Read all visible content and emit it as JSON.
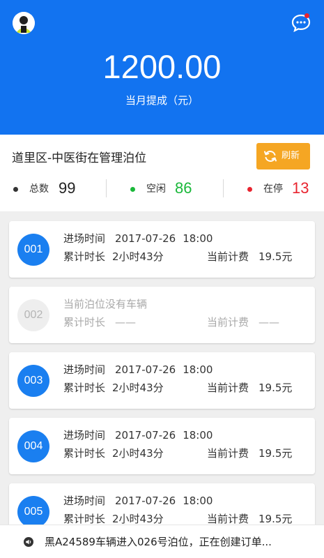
{
  "header": {
    "amount": "1200.00",
    "amount_label": "当月提成（元）"
  },
  "lot": {
    "title": "道里区-中医街在管理泊位",
    "refresh_label": "刷新"
  },
  "stats": {
    "total_label": "总数",
    "total_value": "99",
    "free_label": "空闲",
    "free_value": "86",
    "parked_label": "在停",
    "parked_value": "13"
  },
  "colors": {
    "primary": "#1273f0",
    "refresh": "#f5a623",
    "free": "#1ab83a",
    "parked": "#e8242f"
  },
  "cards": [
    {
      "id": "001",
      "entry_label": "进场时间",
      "entry_date": "2017-07-26",
      "entry_time": "18:00",
      "duration_label": "累计时长",
      "duration": "2小时43分",
      "fee_label": "当前计费",
      "fee": "19.5元"
    },
    {
      "id": "002",
      "empty_text": "当前泊位没有车辆",
      "duration_label": "累计时长",
      "duration": "——",
      "fee_label": "当前计费",
      "fee": "——"
    },
    {
      "id": "003",
      "entry_label": "进场时间",
      "entry_date": "2017-07-26",
      "entry_time": "18:00",
      "duration_label": "累计时长",
      "duration": "2小时43分",
      "fee_label": "当前计费",
      "fee": "19.5元"
    },
    {
      "id": "004",
      "entry_label": "进场时间",
      "entry_date": "2017-07-26",
      "entry_time": "18:00",
      "duration_label": "累计时长",
      "duration": "2小时43分",
      "fee_label": "当前计费",
      "fee": "19.5元"
    },
    {
      "id": "005",
      "entry_label": "进场时间",
      "entry_date": "2017-07-26",
      "entry_time": "18:00",
      "duration_label": "累计时长",
      "duration": "2小时43分",
      "fee_label": "当前计费",
      "fee": "19.5元"
    }
  ],
  "toast": {
    "icon": "speaker-icon",
    "text": "黑A24589车辆进入026号泊位，正在创建订单..."
  }
}
